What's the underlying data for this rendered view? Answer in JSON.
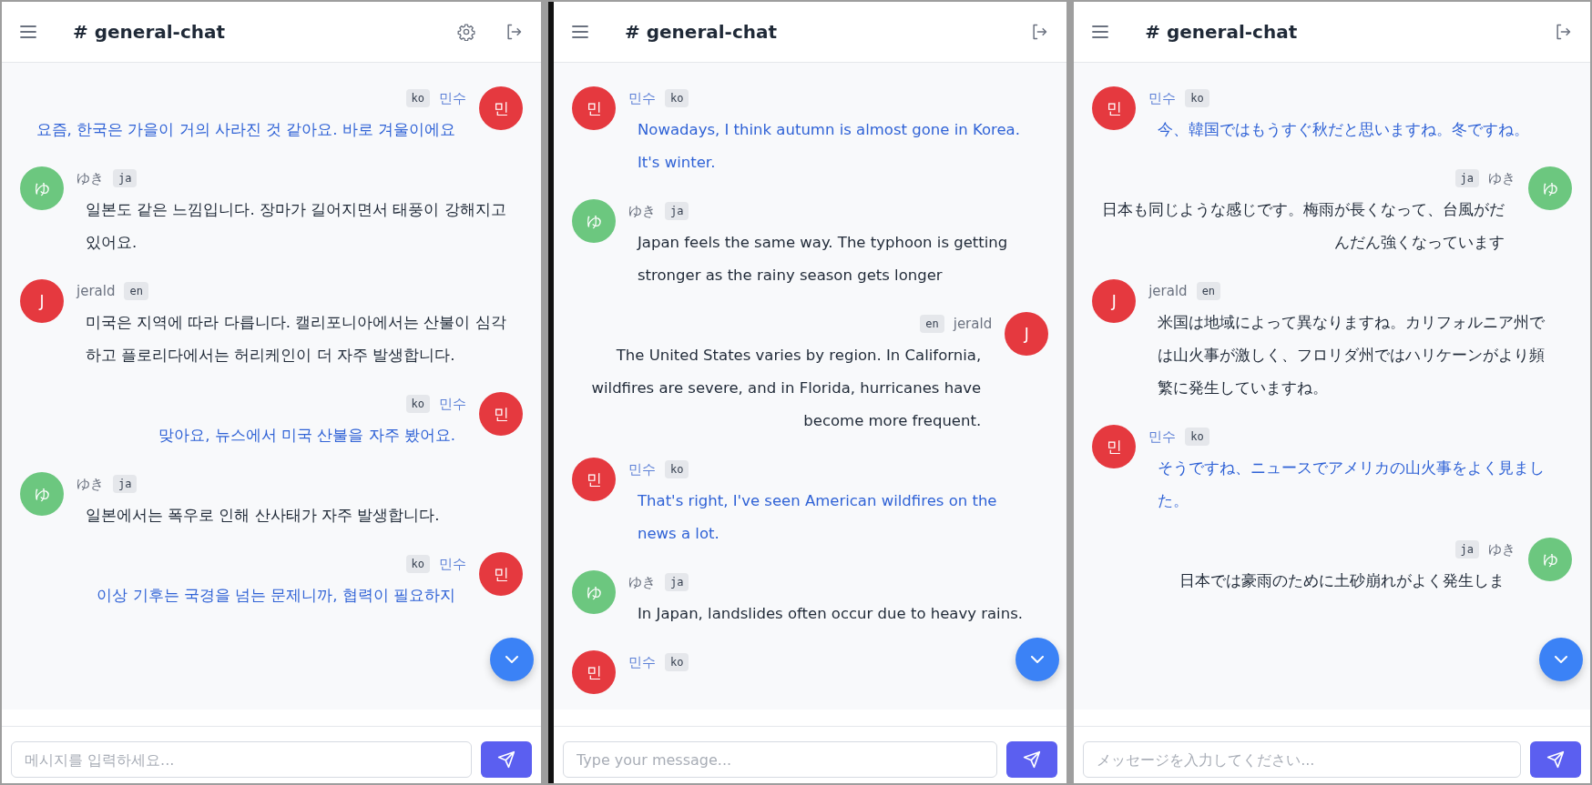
{
  "panels": [
    {
      "header": {
        "title": "# general-chat",
        "actions": [
          {
            "kind": "settings"
          },
          {
            "kind": "logout"
          }
        ]
      },
      "messages": [
        {
          "kind": "outgoing",
          "avatar": "민",
          "color": "#e5393f",
          "name": "민수",
          "lang": "ko",
          "highlighted": true,
          "text": "요즘, 한국은 가을이 거의 사라진 것 같아요. 바로 겨울이에요"
        },
        {
          "kind": "incoming",
          "avatar": "ゆ",
          "color": "#6cc77f",
          "name": "ゆき",
          "lang": "ja",
          "highlighted": false,
          "text": "일본도 같은 느낌입니다. 장마가 길어지면서 태풍이 강해지고 있어요."
        },
        {
          "kind": "incoming",
          "avatar": "J",
          "color": "#e5393f",
          "name": "jerald",
          "lang": "en",
          "highlighted": false,
          "text": "미국은 지역에 따라 다릅니다. 캘리포니아에서는 산불이 심각하고 플로리다에서는 허리케인이 더 자주 발생합니다."
        },
        {
          "kind": "outgoing",
          "avatar": "민",
          "color": "#e5393f",
          "name": "민수",
          "lang": "ko",
          "highlighted": true,
          "text": "맞아요, 뉴스에서 미국 산불을 자주 봤어요."
        },
        {
          "kind": "incoming",
          "avatar": "ゆ",
          "color": "#6cc77f",
          "name": "ゆき",
          "lang": "ja",
          "highlighted": false,
          "text": "일본에서는 폭우로 인해 산사태가 자주 발생합니다."
        },
        {
          "kind": "outgoing",
          "avatar": "민",
          "color": "#e5393f",
          "name": "민수",
          "lang": "ko",
          "highlighted": true,
          "text": "이상 기후는 국경을 넘는 문제니까, 협력이 필요하지"
        }
      ],
      "composer": {
        "placeholder": "메시지를 입력하세요..."
      }
    },
    {
      "header": {
        "title": "# general-chat",
        "actions": [
          {
            "kind": "logout"
          }
        ]
      },
      "messages": [
        {
          "kind": "incoming",
          "avatar": "민",
          "color": "#e5393f",
          "name": "민수",
          "lang": "ko",
          "highlighted": true,
          "text": "Nowadays, I think autumn is almost gone in Korea. It's winter."
        },
        {
          "kind": "incoming",
          "avatar": "ゆ",
          "color": "#6cc77f",
          "name": "ゆき",
          "lang": "ja",
          "highlighted": false,
          "text": "Japan feels the same way. The typhoon is getting stronger as the rainy season gets longer"
        },
        {
          "kind": "outgoing",
          "avatar": "J",
          "color": "#e5393f",
          "name": "jerald",
          "lang": "en",
          "highlighted": false,
          "text": "The United States varies by region. In California, wildfires are severe, and in Florida, hurricanes have become more frequent."
        },
        {
          "kind": "incoming",
          "avatar": "민",
          "color": "#e5393f",
          "name": "민수",
          "lang": "ko",
          "highlighted": true,
          "text": "That's right, I've seen American wildfires on the news a lot."
        },
        {
          "kind": "incoming",
          "avatar": "ゆ",
          "color": "#6cc77f",
          "name": "ゆき",
          "lang": "ja",
          "highlighted": false,
          "text": "In Japan, landslides often occur due to heavy rains."
        },
        {
          "kind": "incoming",
          "avatar": "민",
          "color": "#e5393f",
          "name": "민수",
          "lang": "ko",
          "highlighted": true
        }
      ],
      "composer": {
        "placeholder": "Type your message..."
      }
    },
    {
      "header": {
        "title": "# general-chat",
        "actions": [
          {
            "kind": "logout"
          }
        ]
      },
      "messages": [
        {
          "kind": "incoming",
          "avatar": "민",
          "color": "#e5393f",
          "name": "민수",
          "lang": "ko",
          "highlighted": true,
          "text": "今、韓国ではもうすぐ秋だと思いますね。冬ですね。"
        },
        {
          "kind": "outgoing",
          "avatar": "ゆ",
          "color": "#6cc77f",
          "name": "ゆき",
          "lang": "ja",
          "highlighted": false,
          "text": "日本も同じような感じです。梅雨が長くなって、台風がだんだん強くなっています"
        },
        {
          "kind": "incoming",
          "avatar": "J",
          "color": "#e5393f",
          "name": "jerald",
          "lang": "en",
          "highlighted": false,
          "text": "米国は地域によって異なりますね。カリフォルニア州では山火事が激しく、フロリダ州ではハリケーンがより頻繁に発生していますね。"
        },
        {
          "kind": "incoming",
          "avatar": "민",
          "color": "#e5393f",
          "name": "민수",
          "lang": "ko",
          "highlighted": true,
          "text": "そうですね、ニュースでアメリカの山火事をよく見ました。"
        },
        {
          "kind": "outgoing",
          "avatar": "ゆ",
          "color": "#6cc77f",
          "name": "ゆき",
          "lang": "ja",
          "highlighted": false,
          "text": "日本では豪雨のために土砂崩れがよく発生しま"
        }
      ],
      "composer": {
        "placeholder": "メッセージを入力してください..."
      }
    }
  ]
}
